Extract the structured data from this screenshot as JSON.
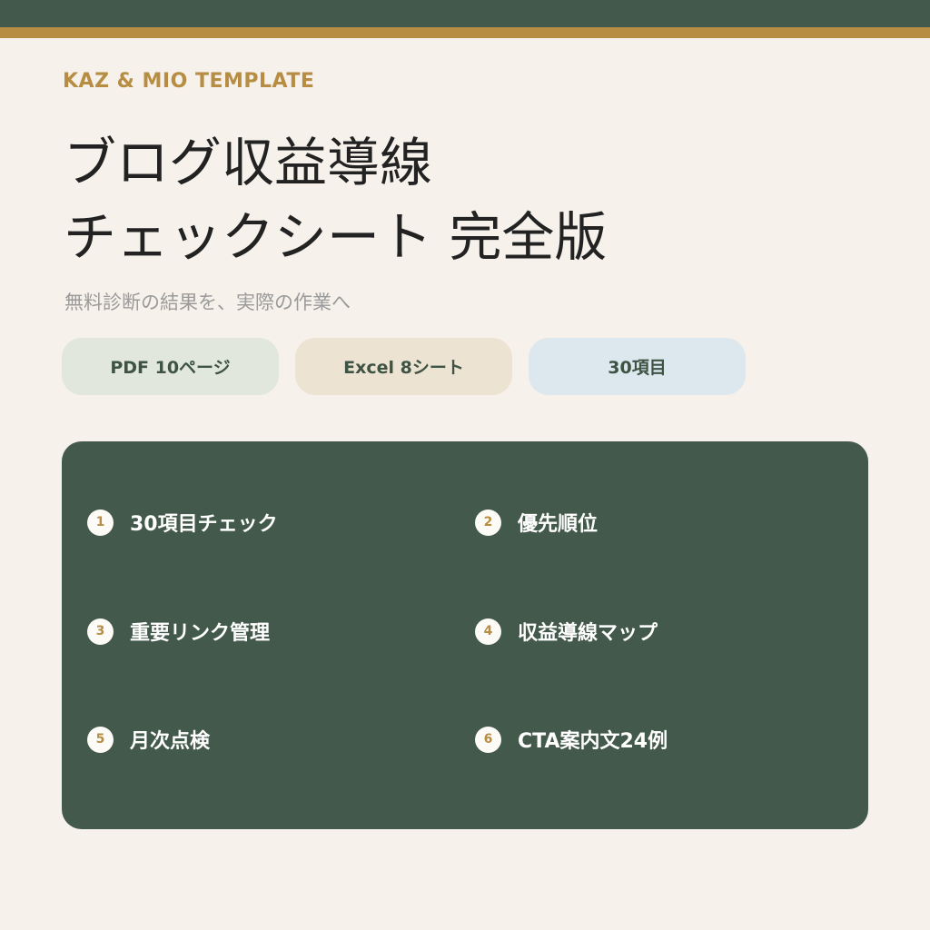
{
  "brand": "KAZ & MIO TEMPLATE",
  "title": {
    "line1": "ブログ収益導線",
    "line2": "チェックシート 完全版"
  },
  "subtitle": "無料診断の結果を、実際の作業へ",
  "chips": [
    {
      "label": "PDF 10ページ",
      "color": "#e1e7dd"
    },
    {
      "label": "Excel 8シート",
      "color": "#ede3d3"
    },
    {
      "label": "30項目",
      "color": "#dce8ee"
    }
  ],
  "features": [
    {
      "number": "1",
      "label": "30項目チェック"
    },
    {
      "number": "2",
      "label": "優先順位"
    },
    {
      "number": "3",
      "label": "重要リンク管理"
    },
    {
      "number": "4",
      "label": "収益導線マップ"
    },
    {
      "number": "5",
      "label": "月次点検"
    },
    {
      "number": "6",
      "label": "CTA案内文24例"
    }
  ],
  "colors": {
    "primary_green": "#43594b",
    "accent_gold": "#b68d42",
    "background": "#f6f1ea"
  }
}
